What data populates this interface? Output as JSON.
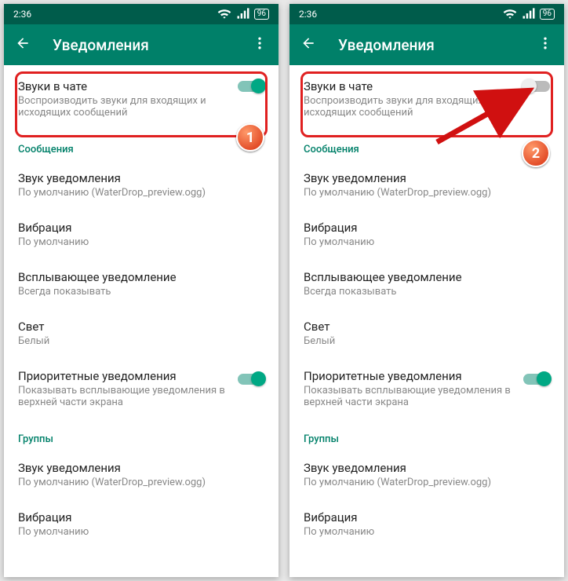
{
  "status": {
    "time": "2:36",
    "battery": "96"
  },
  "header": {
    "title": "Уведомления"
  },
  "chatSounds": {
    "label": "Звуки в чате",
    "sub": "Воспроизводить звуки для входящих и исходящих сообщений"
  },
  "sections": {
    "messages": "Сообщения",
    "groups": "Группы"
  },
  "items": {
    "notifSound": {
      "label": "Звук уведомления",
      "sub": "По умолчанию (WaterDrop_preview.ogg)"
    },
    "vibration": {
      "label": "Вибрация",
      "sub": "По умолчанию"
    },
    "popup": {
      "label": "Всплывающее уведомление",
      "sub": "Всегда показывать"
    },
    "light": {
      "label": "Свет",
      "sub": "Белый"
    },
    "priority": {
      "label": "Приоритетные уведомления",
      "sub": "Показывать всплывающие уведомления в верхней части экрана"
    },
    "groupSound": {
      "label": "Звук уведомления",
      "sub": "По умолчанию (WaterDrop_preview.ogg)"
    },
    "groupVibration": {
      "label": "Вибрация",
      "sub": "По умолчанию"
    }
  },
  "callouts": {
    "one": "1",
    "two": "2"
  }
}
